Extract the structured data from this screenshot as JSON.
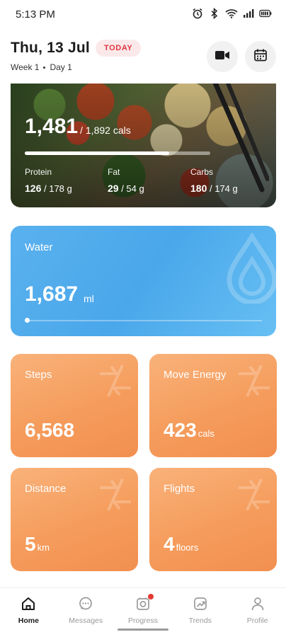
{
  "status_bar": {
    "time": "5:13 PM",
    "icons": [
      "alarm-icon",
      "bluetooth-icon",
      "wifi-icon",
      "signal-icon",
      "battery-icon"
    ]
  },
  "header": {
    "date": "Thu, 13 Jul",
    "today_badge": "TODAY",
    "week": "Week 1",
    "day": "Day 1"
  },
  "calories": {
    "consumed": "1,481",
    "separator": "/",
    "target": "1,892 cals",
    "progress": 0.78,
    "macros": [
      {
        "label": "Protein",
        "value": "126",
        "target": "/ 178 g"
      },
      {
        "label": "Fat",
        "value": "29",
        "target": "/ 54 g"
      },
      {
        "label": "Carbs",
        "value": "180",
        "target": "/ 174 g"
      }
    ]
  },
  "water": {
    "title": "Water",
    "value": "1,687",
    "unit": "ml"
  },
  "stats": [
    {
      "title": "Steps",
      "value": "6,568",
      "unit": ""
    },
    {
      "title": "Move Energy",
      "value": "423",
      "unit": "cals"
    },
    {
      "title": "Distance",
      "value": "5",
      "unit": "km"
    },
    {
      "title": "Flights",
      "value": "4",
      "unit": "floors"
    }
  ],
  "nav": [
    {
      "label": "Home",
      "icon": "home-icon",
      "active": true
    },
    {
      "label": "Messages",
      "icon": "messages-icon",
      "active": false
    },
    {
      "label": "Progress",
      "icon": "progress-icon",
      "active": false
    },
    {
      "label": "Trends",
      "icon": "trends-icon",
      "active": false
    },
    {
      "label": "Profile",
      "icon": "profile-icon",
      "active": false
    }
  ],
  "colors": {
    "accent_red": "#e0343f",
    "water_blue": "#4aa7ea",
    "stat_orange": "#f59c5c"
  }
}
